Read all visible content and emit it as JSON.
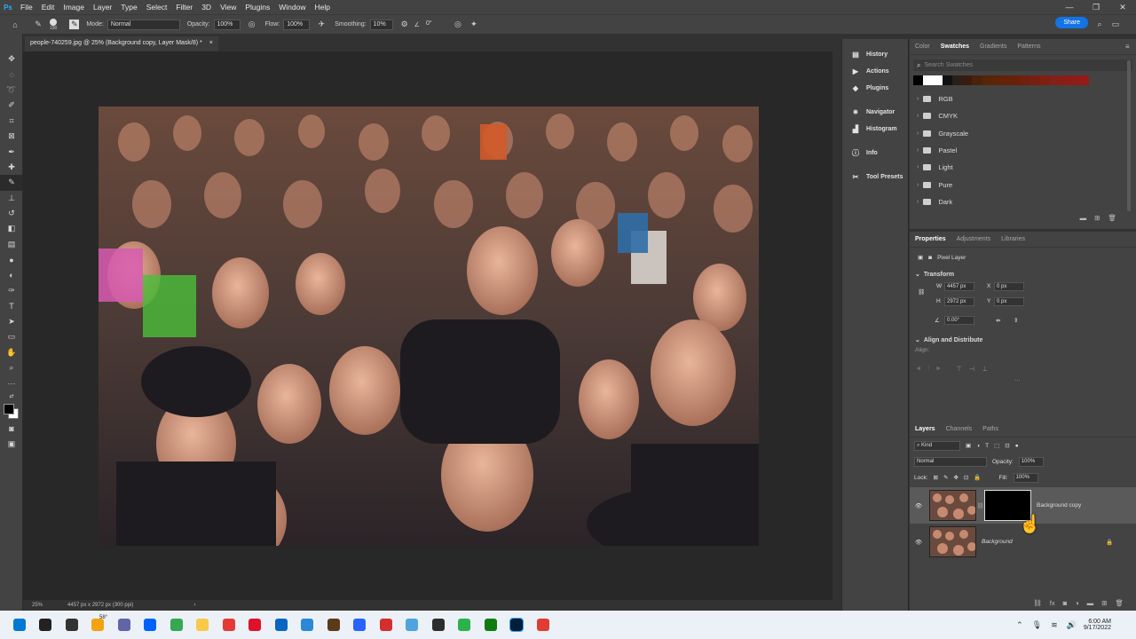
{
  "menu": {
    "app_icon": "Ps",
    "items": [
      "File",
      "Edit",
      "Image",
      "Layer",
      "Type",
      "Select",
      "Filter",
      "3D",
      "View",
      "Plugins",
      "Window",
      "Help"
    ]
  },
  "window_controls": [
    "—",
    "❐",
    "✕"
  ],
  "options_bar": {
    "brush_size": "190",
    "mode_label": "Mode:",
    "mode_value": "Normal",
    "opacity_label": "Opacity:",
    "opacity_value": "100%",
    "flow_label": "Flow:",
    "flow_value": "100%",
    "smoothing_label": "Smoothing:",
    "smoothing_value": "10%",
    "angle_value": "0°",
    "share_label": "Share"
  },
  "document_tab": {
    "title": "people-740259.jpg @ 25% (Background copy, Layer Mask/8) *",
    "close": "×"
  },
  "status_bar": {
    "zoom": "25%",
    "doc_info": "4457 px x 2972 px (300 ppi)",
    "arrow": "›"
  },
  "dock_panels": [
    {
      "label": "History",
      "icon": "history-icon"
    },
    {
      "label": "Actions",
      "icon": "play-icon"
    },
    {
      "label": "Plugins",
      "icon": "plugins-icon"
    },
    {
      "label": "Navigator",
      "icon": "navigator-icon"
    },
    {
      "label": "Histogram",
      "icon": "histogram-icon"
    },
    {
      "label": "Info",
      "icon": "info-icon"
    },
    {
      "label": "Tool Presets",
      "icon": "tool-presets-icon"
    }
  ],
  "swatches_panel": {
    "tabs": [
      "Color",
      "Swatches",
      "Gradients",
      "Patterns"
    ],
    "active_tab": "Swatches",
    "search_placeholder": "Search Swatches",
    "recent_colors": [
      "#000000",
      "#ffffff",
      "#ffffff",
      "#111111",
      "#2a1f1b",
      "#3a1c0e",
      "#4a220b",
      "#552509",
      "#5c2409",
      "#642309",
      "#6a2109",
      "#702010",
      "#78200e",
      "#7e1f10",
      "#84201a",
      "#8a1e14",
      "#8f1c16",
      "#951a18"
    ],
    "folders": [
      "RGB",
      "CMYK",
      "Grayscale",
      "Pastel",
      "Light",
      "Pure",
      "Dark"
    ]
  },
  "properties_panel": {
    "tabs": [
      "Properties",
      "Adjustments",
      "Libraries"
    ],
    "active_tab": "Properties",
    "layer_type": "Pixel Layer",
    "transform_heading": "Transform",
    "w_label": "W",
    "w_value": "4457 px",
    "h_label": "H",
    "h_value": "2972 px",
    "x_label": "X",
    "x_value": "0 px",
    "y_label": "Y",
    "y_value": "0 px",
    "angle_value": "0.00°",
    "align_heading": "Align and Distribute",
    "align_label": "Align:",
    "more": "···"
  },
  "layers_panel": {
    "tabs": [
      "Layers",
      "Channels",
      "Paths"
    ],
    "active_tab": "Layers",
    "filter_kind": "Kind",
    "blend_mode": "Normal",
    "opacity_label": "Opacity:",
    "opacity_value": "100%",
    "lock_label": "Lock:",
    "fill_label": "Fill:",
    "fill_value": "100%",
    "layers": [
      {
        "name": "Background copy",
        "has_mask": true,
        "selected": true,
        "locked": false
      },
      {
        "name": "Background",
        "has_mask": false,
        "selected": false,
        "locked": true
      }
    ]
  },
  "taskbar": {
    "weather": "58°",
    "time": "6:00 AM",
    "date": "9/17/2022",
    "apps": [
      {
        "name": "windows-start-icon",
        "color": "#0078d4"
      },
      {
        "name": "search-icon",
        "color": "#222222"
      },
      {
        "name": "task-view-icon",
        "color": "#333333"
      },
      {
        "name": "weather-widget-icon",
        "color": "#f2a30f"
      },
      {
        "name": "teams-chat-icon",
        "color": "#6264a7"
      },
      {
        "name": "dropbox-icon",
        "color": "#0061fe"
      },
      {
        "name": "chrome-icon",
        "color": "#34a853"
      },
      {
        "name": "file-explorer-icon",
        "color": "#f8c94b"
      },
      {
        "name": "app-red-diamond-icon",
        "color": "#e53935"
      },
      {
        "name": "opera-icon",
        "color": "#e0112b"
      },
      {
        "name": "mail-icon",
        "color": "#0a66c2"
      },
      {
        "name": "vscode-like-icon",
        "color": "#2b88d8"
      },
      {
        "name": "app-brown-icon",
        "color": "#5b3a1a"
      },
      {
        "name": "app-blue-doc-icon",
        "color": "#2962ff"
      },
      {
        "name": "snipping-tool-icon",
        "color": "#d32f2f"
      },
      {
        "name": "photos-icon",
        "color": "#4fa3e0"
      },
      {
        "name": "app-circle-icon",
        "color": "#2d2d2d"
      },
      {
        "name": "camtasia-icon",
        "color": "#2bb24c"
      },
      {
        "name": "app-green-icon",
        "color": "#107c10"
      },
      {
        "name": "photoshop-icon",
        "color": "#001e36"
      },
      {
        "name": "app-red-icon",
        "color": "#e03c31"
      }
    ]
  }
}
